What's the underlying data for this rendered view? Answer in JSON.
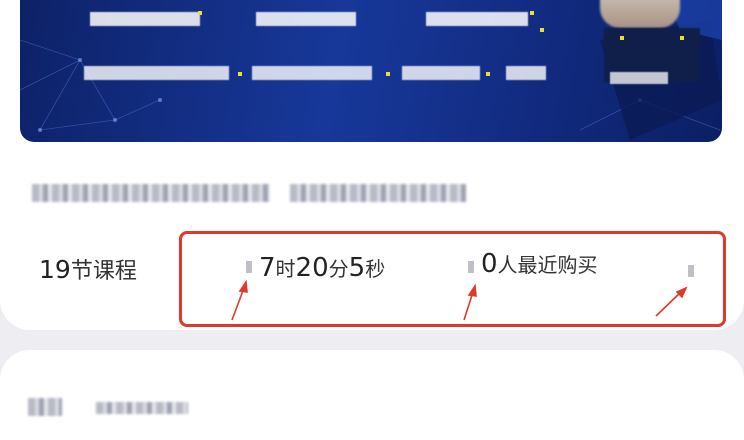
{
  "course": {
    "lesson_count": "19",
    "lesson_unit": "节课程",
    "duration": {
      "hours": "7",
      "hours_unit": "时",
      "minutes": "20",
      "minutes_unit": "分",
      "seconds": "5",
      "seconds_unit": "秒"
    },
    "buyers": {
      "count": "0",
      "label": "人最近购买"
    }
  },
  "colors": {
    "highlight_border": "#e0382a",
    "annotation_arrow": "#e0382a",
    "banner_bg": "#17389a"
  }
}
